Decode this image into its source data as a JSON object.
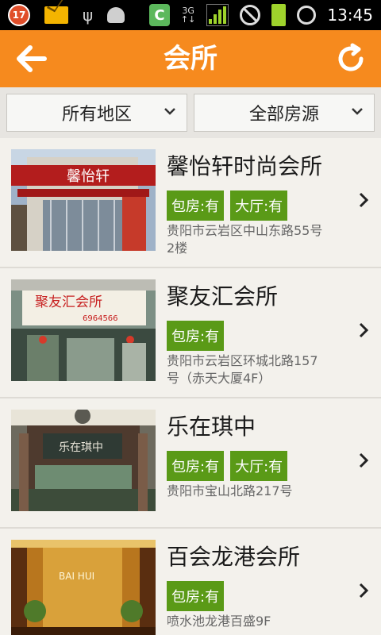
{
  "status_bar": {
    "notification_count": "17",
    "network_type": "3G",
    "network_type2": "3G",
    "time": "13:45"
  },
  "header": {
    "title": "会所"
  },
  "filters": {
    "region_label": "所有地区",
    "source_label": "全部房源"
  },
  "listings": [
    {
      "name": "馨怡轩时尚会所",
      "tags": [
        "包房:有",
        "大厅:有"
      ],
      "address": "贵阳市云岩区中山东路55号2楼"
    },
    {
      "name": "聚友汇会所",
      "tags": [
        "包房:有"
      ],
      "address": "贵阳市云岩区环城北路157号（赤天大厦4F）"
    },
    {
      "name": "乐在琪中",
      "tags": [
        "包房:有",
        "大厅:有"
      ],
      "address": "贵阳市宝山北路217号"
    },
    {
      "name": "百会龙港会所",
      "tags": [
        "包房:有"
      ],
      "address": "喷水池龙港百盛9F"
    }
  ],
  "thumb_text": {
    "item1": "馨怡轩",
    "item2_line1": "聚友汇会所",
    "item2_line2": "6964566",
    "item3": "乐在琪中",
    "item4": "BAI HUI"
  },
  "colors": {
    "header_bg": "#f68a1e",
    "tag_bg": "#5a9a17"
  }
}
